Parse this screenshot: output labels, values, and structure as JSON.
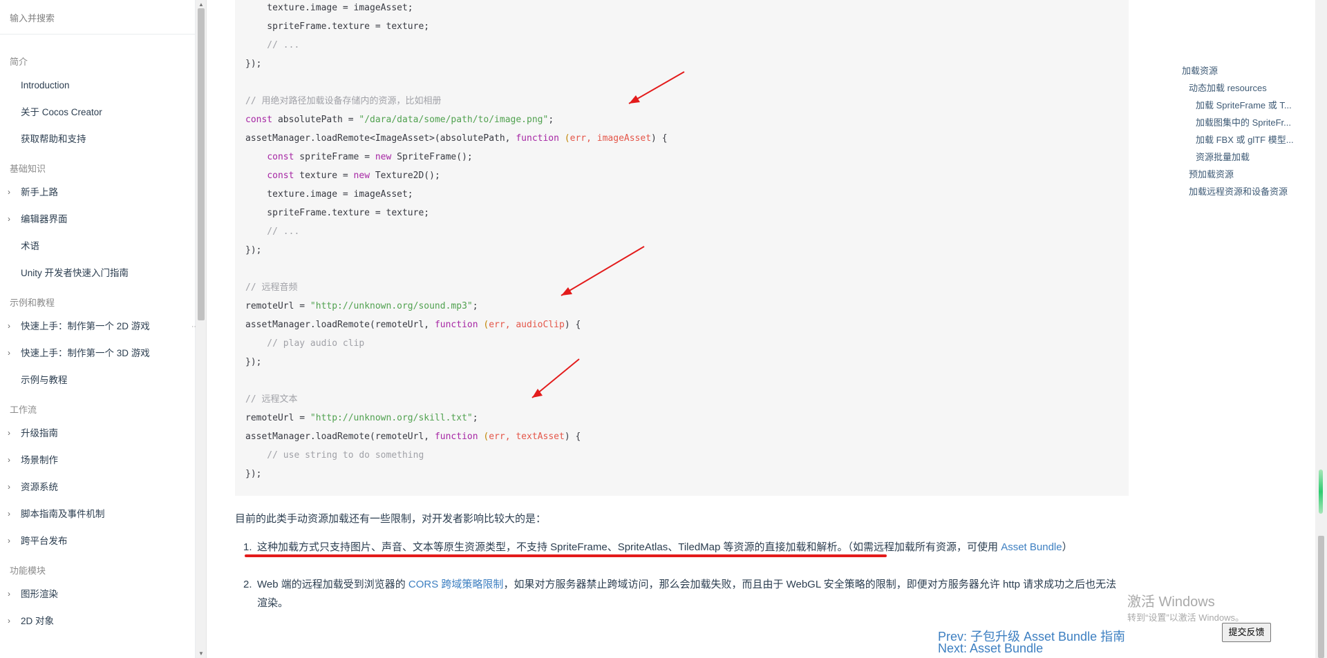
{
  "sidebar": {
    "search_placeholder": "输入并搜索",
    "groups": [
      {
        "title": "简介",
        "items": [
          "Introduction",
          "关于 Cocos Creator",
          "获取帮助和支持"
        ]
      },
      {
        "title": "基础知识",
        "items": [
          "新手上路",
          "编辑器界面",
          "术语",
          "Unity 开发者快速入门指南"
        ]
      },
      {
        "title": "示例和教程",
        "items": [
          "快速上手：制作第一个 2D 游戏",
          "快速上手：制作第一个 3D 游戏",
          "示例与教程"
        ]
      },
      {
        "title": "工作流",
        "items": [
          "升级指南",
          "场景制作",
          "资源系统",
          "脚本指南及事件机制",
          "跨平台发布"
        ]
      },
      {
        "title": "功能模块",
        "items": [
          "图形渲染",
          "2D 对象"
        ]
      }
    ]
  },
  "code": {
    "l1": "    texture.image = imageAsset;",
    "l2": "    spriteFrame.texture = texture;",
    "l3": "    // ...",
    "l4": "});",
    "c1": "// 用绝对路径加载设备存储内的资源，比如相册",
    "const": "const",
    "new": "new",
    "function": "function",
    "absolutePath_decl": " absolutePath = ",
    "absolutePath_str": "\"/dara/data/some/path/to/image.png\"",
    "semicolon": ";",
    "load1_a": "assetManager.loadRemote<ImageAsset>(absolutePath, ",
    "paren_open": " (",
    "err": "err",
    "comma": ", ",
    "imageAsset": "imageAsset",
    "close_brace": ") {",
    "sf_a": " spriteFrame = ",
    "sf_b": " SpriteFrame();",
    "tx_a": " texture = ",
    "tx_b": " Texture2D();",
    "c2": "// 远程音频",
    "remote1_a": "remoteUrl = ",
    "remote1_str": "\"http://unknown.org/sound.mp3\"",
    "load_remote": "assetManager.loadRemote(remoteUrl, ",
    "audioClip": "audioClip",
    "play": "    // play audio clip",
    "c3": "// 远程文本",
    "remote2_str": "\"http://unknown.org/skill.txt\"",
    "textAsset": "textAsset",
    "use_string": "    // use string to do something"
  },
  "content": {
    "intro": "目前的此类手动资源加载还有一些限制，对开发者影响比较大的是：",
    "item1_num": "1.",
    "item1_text": "这种加载方式只支持图片、声音、文本等原生资源类型，不支持 SpriteFrame、SpriteAtlas、TiledMap 等资源的直接加载和解析。（如需远程加载所有资源，可使用 ",
    "item1_link": "Asset Bundle",
    "item1_end": "）",
    "item2_num": "2.",
    "item2_text_a": "Web 端的远程加载受到浏览器的 ",
    "item2_link": "CORS 跨域策略限制",
    "item2_text_b": "，如果对方服务器禁止跨域访问，那么会加载失败，而且由于 WebGL 安全策略的限制，即便对方服务器允许 http 请求成功之后也无法渲染。",
    "prev": "Prev: 子包升级 Asset Bundle 指南",
    "next": "Next: Asset Bundle"
  },
  "toc": [
    {
      "label": "加载资源",
      "level": 0
    },
    {
      "label": "动态加载 resources",
      "level": 1
    },
    {
      "label": "加载 SpriteFrame 或 T...",
      "level": 2
    },
    {
      "label": "加载图集中的 SpriteFr...",
      "level": 2
    },
    {
      "label": "加载 FBX 或 glTF 模型...",
      "level": 2
    },
    {
      "label": "资源批量加载",
      "level": 2
    },
    {
      "label": "预加载资源",
      "level": 1
    },
    {
      "label": "加载远程资源和设备资源",
      "level": 1
    }
  ],
  "watermark": {
    "line1": "激活 Windows",
    "line2": "转到“设置”以激活 Windows。"
  },
  "feedback_label": "提交反馈",
  "colors": {
    "link": "#3d7fc1",
    "annotation_red": "#e31b1b",
    "code_bg": "#f6f6f6"
  }
}
